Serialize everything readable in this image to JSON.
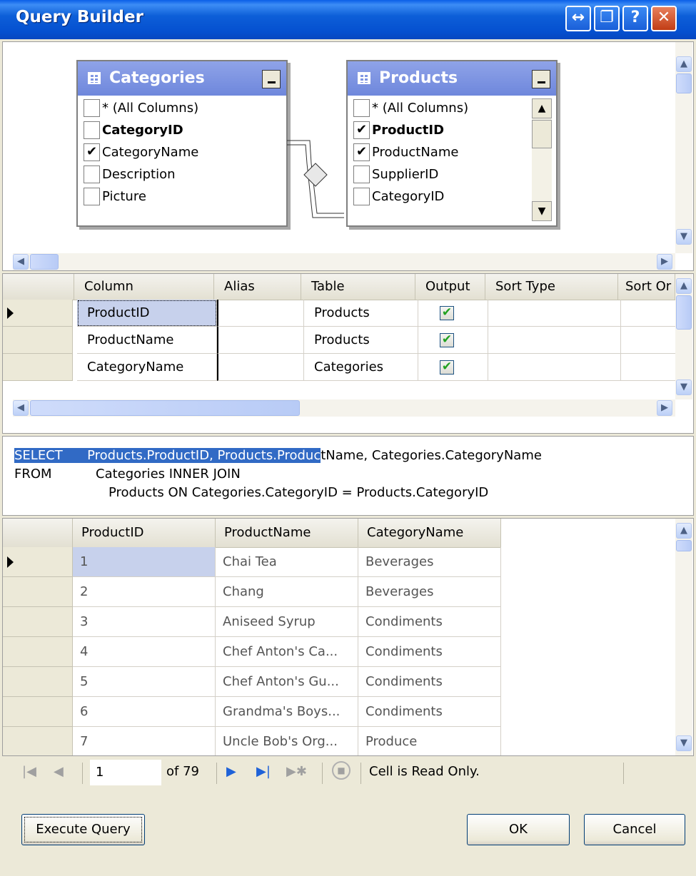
{
  "window": {
    "title": "Query Builder"
  },
  "titlebar_buttons": {
    "resize": "↔",
    "restore": "❐",
    "help": "?",
    "close": "✕"
  },
  "diagram": {
    "categories_table": {
      "title": "Categories",
      "columns": [
        {
          "label": "* (All Columns)",
          "checked": false,
          "bold": false
        },
        {
          "label": "CategoryID",
          "checked": false,
          "bold": true
        },
        {
          "label": "CategoryName",
          "checked": true,
          "bold": false
        },
        {
          "label": "Description",
          "checked": false,
          "bold": false
        },
        {
          "label": "Picture",
          "checked": false,
          "bold": false
        }
      ]
    },
    "products_table": {
      "title": "Products",
      "columns": [
        {
          "label": "* (All Columns)",
          "checked": false,
          "bold": false
        },
        {
          "label": "ProductID",
          "checked": true,
          "bold": true
        },
        {
          "label": "ProductName",
          "checked": true,
          "bold": false
        },
        {
          "label": "SupplierID",
          "checked": false,
          "bold": false
        },
        {
          "label": "CategoryID",
          "checked": false,
          "bold": false
        }
      ]
    }
  },
  "criteria": {
    "headers": [
      "Column",
      "Alias",
      "Table",
      "Output",
      "Sort Type",
      "Sort Or"
    ],
    "rows": [
      {
        "column": "ProductID",
        "alias": "",
        "table": "Products",
        "output": true
      },
      {
        "column": "ProductName",
        "alias": "",
        "table": "Products",
        "output": true
      },
      {
        "column": "CategoryName",
        "alias": "",
        "table": "Categories",
        "output": true
      }
    ]
  },
  "sql": {
    "line1_keyword": "SELECT",
    "line1_selected": "Products.ProductID, Products.Produc",
    "line1_rest": "tName, Categories.CategoryName",
    "line2_keyword": "FROM",
    "line2_text": "Categories INNER JOIN",
    "line3_text": "Products ON Categories.CategoryID = Products.CategoryID"
  },
  "results": {
    "headers": [
      "ProductID",
      "ProductName",
      "CategoryName"
    ],
    "rows": [
      {
        "id": "1",
        "name": "Chai Tea",
        "category": "Beverages"
      },
      {
        "id": "2",
        "name": "Chang",
        "category": "Beverages"
      },
      {
        "id": "3",
        "name": "Aniseed Syrup",
        "category": "Condiments"
      },
      {
        "id": "4",
        "name": "Chef Anton's Ca...",
        "category": "Condiments"
      },
      {
        "id": "5",
        "name": "Chef Anton's Gu...",
        "category": "Condiments"
      },
      {
        "id": "6",
        "name": "Grandma's Boys...",
        "category": "Condiments"
      },
      {
        "id": "7",
        "name": "Uncle Bob's Org...",
        "category": "Produce"
      }
    ]
  },
  "navigator": {
    "position": "1",
    "of_label": "of 79",
    "status": "Cell is Read Only."
  },
  "buttons": {
    "execute_query": "Execute Query",
    "ok": "OK",
    "cancel": "Cancel"
  },
  "colors": {
    "titlebar": "#0550d0",
    "table_header": "#7b92e0",
    "selection": "#316ac5",
    "dialog_bg": "#ece9d8"
  }
}
